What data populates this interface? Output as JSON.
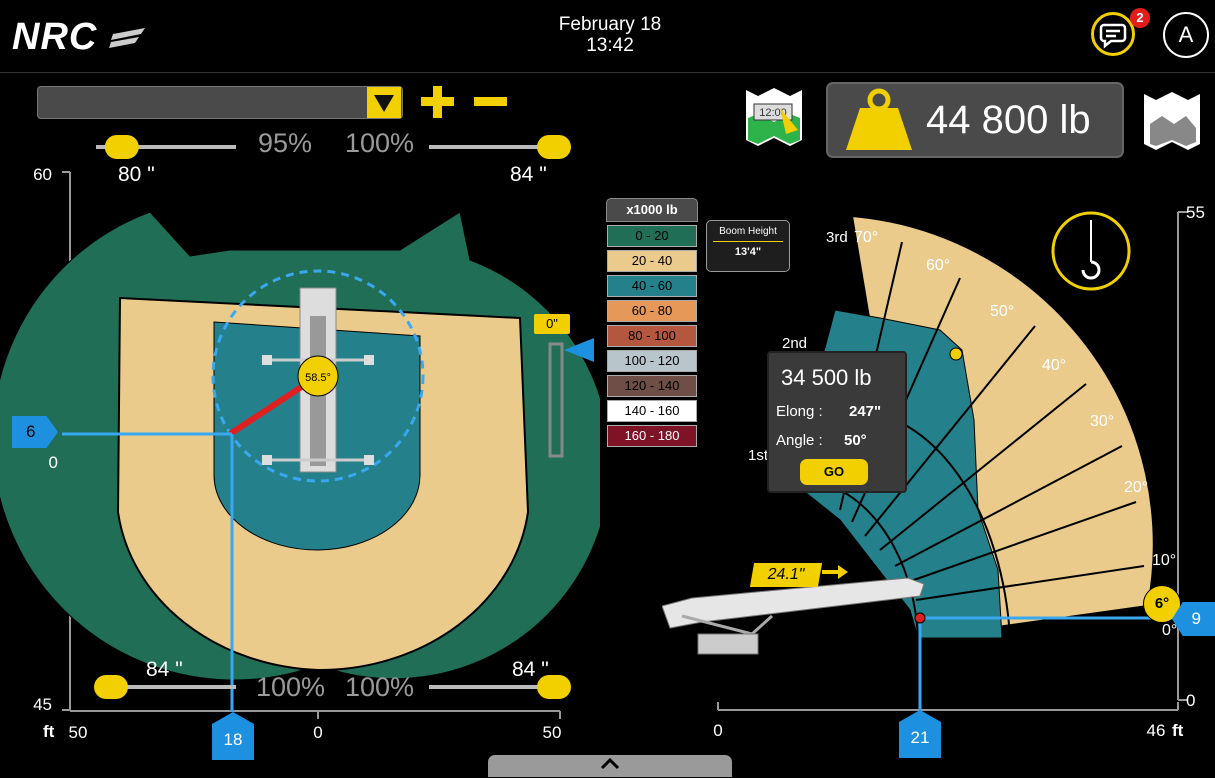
{
  "header": {
    "logo": "NRC",
    "date": "February 18",
    "time": "13:42",
    "notifications_count": "2",
    "avatar_letter": "A"
  },
  "controls": {
    "dropdown_value": "",
    "outrigger_pct_left": "95%",
    "outrigger_pct_right": "100%",
    "outrigger_pct_bottom_left": "100%",
    "outrigger_pct_bottom_right": "100%",
    "top_left_dim": "80 \"",
    "top_right_dim": "84 \"",
    "bottom_left_dim": "84 \"",
    "bottom_right_dim": "84 \"",
    "top_left_slider_value": 0.1,
    "top_right_slider_value": 1.0,
    "bottom_left_slider_value": 0.0,
    "bottom_right_slider_value": 1.0
  },
  "load": {
    "value": "44 800 lb",
    "monitor_value": "12:00"
  },
  "plan_view": {
    "y_top": "60",
    "y_mid": "0",
    "y_bottom": "45",
    "x_left": "50",
    "x_mid": "0",
    "x_right": "50",
    "unit": "ft",
    "slew_angle": "58.5°",
    "rotation_offset": "0\"",
    "left_marker": "6",
    "bottom_marker": "18"
  },
  "legend": {
    "title": "x1000 lb",
    "items": [
      {
        "label": "0 - 20",
        "color": "#1f6e55",
        "text": "#000000"
      },
      {
        "label": "20 - 40",
        "color": "#eacb8b",
        "text": "#000000"
      },
      {
        "label": "40 - 60",
        "color": "#24808a",
        "text": "#000000"
      },
      {
        "label": "60 - 80",
        "color": "#e59858",
        "text": "#000000"
      },
      {
        "label": "80 - 100",
        "color": "#b4573e",
        "text": "#000000"
      },
      {
        "label": "100 - 120",
        "color": "#b8c6cc",
        "text": "#000000"
      },
      {
        "label": "120 - 140",
        "color": "#6e4e46",
        "text": "#000000"
      },
      {
        "label": "140 - 160",
        "color": "#ffffff",
        "text": "#000000"
      },
      {
        "label": "160 - 180",
        "color": "#7d1325",
        "text": "#ffffff"
      }
    ]
  },
  "boom_height": {
    "label": "Boom Height",
    "value": "13'4\""
  },
  "elevation_view": {
    "angles": [
      "0°",
      "10°",
      "20°",
      "30°",
      "40°",
      "50°",
      "60°",
      "70°"
    ],
    "sections": [
      "1st",
      "2nd",
      "3rd"
    ],
    "y_top": "55",
    "y_bottom": "0",
    "x_left": "0",
    "x_right": "46",
    "unit": "ft",
    "boom_angle": "6°",
    "extension": "24.1\"",
    "right_marker": "9",
    "bottom_marker": "21"
  },
  "popup": {
    "load": "34 500 lb",
    "elong_label": "Elong :",
    "elong_value": "247\"",
    "angle_label": "Angle :",
    "angle_value": "50°",
    "go_label": "GO"
  },
  "colors": {
    "accent": "#f2d000",
    "marker_blue": "#1e90e0",
    "zone_green": "#1f6e55",
    "zone_sand": "#eacb8b",
    "zone_teal": "#24808a"
  }
}
